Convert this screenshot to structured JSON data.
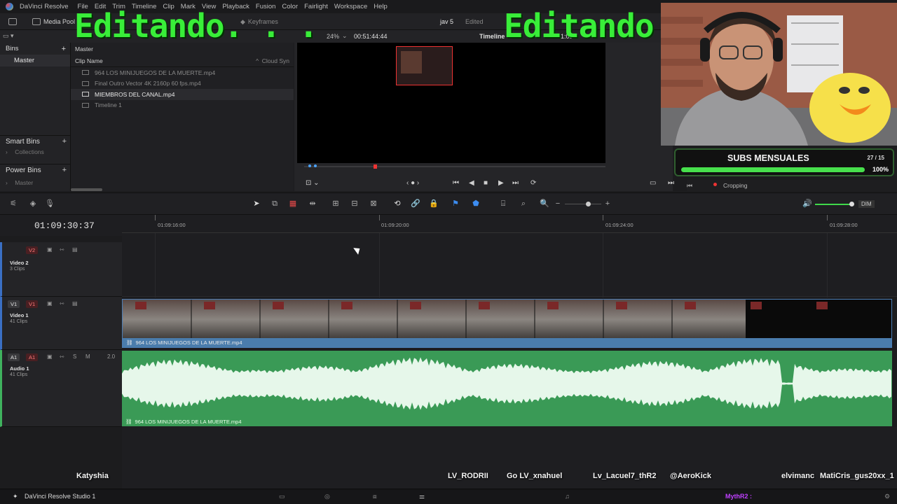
{
  "menubar": {
    "app_name": "DaVinci Resolve",
    "items": [
      "File",
      "Edit",
      "Trim",
      "Timeline",
      "Clip",
      "Mark",
      "View",
      "Playback",
      "Fusion",
      "Color",
      "Fairlight",
      "Workspace",
      "Help"
    ]
  },
  "toolbar": {
    "media_pool": "Media Pool",
    "keyframes": "Keyframes",
    "project_name": "jav 5",
    "project_status": "Edited",
    "zoom": "24%",
    "source_timecode": "00:51:44:44",
    "timeline_label": "Timeline",
    "timeline_tc_partial": "1:09"
  },
  "bins": {
    "header": "Bins",
    "master": "Master",
    "smart_bins": "Smart Bins",
    "collections": "Collections",
    "power_bins": "Power Bins",
    "power_master": "Master"
  },
  "cliplist": {
    "breadcrumb": "Master",
    "col_name": "Clip Name",
    "col_sync": "Cloud Syn",
    "clips": [
      {
        "name": "964 LOS MINIJUEGOS DE LA MUERTE.mp4"
      },
      {
        "name": "Final Outro Vector 4K 2160p 60 fps.mp4"
      },
      {
        "name": "MIEMBROS DEL CANAL.mp4"
      },
      {
        "name": "Timeline 1"
      }
    ]
  },
  "overlay": {
    "title_left": "Editando. . .",
    "title_right": "Editando"
  },
  "subs_widget": {
    "title": "SUBS MENSUALES",
    "count": "27 / 15",
    "percent_label": "100%",
    "fill_fraction": 1.0
  },
  "viewer": {
    "cropping_label": "Cropping"
  },
  "timeline": {
    "timecode": "01:09:30:37",
    "ruler_labels": [
      "01:09:16:00",
      "01:09:20:00",
      "01:09:24:00",
      "01:09:28:00"
    ],
    "dim_label": "DIM",
    "tracks": {
      "v2": {
        "badge": "V2",
        "name": "Video 2",
        "clips": "3 Clips"
      },
      "v1": {
        "badge_a": "V1",
        "badge_b": "V1",
        "name": "Video 1",
        "clips": "41 Clips",
        "clip_label": "964 LOS MINIJUEGOS DE LA MUERTE.mp4"
      },
      "a1": {
        "badge_a": "A1",
        "badge_b": "A1",
        "name": "Audio 1",
        "clips": "41 Clips",
        "level": "2.0",
        "solo": "S",
        "mute": "M",
        "clip_label": "964 LOS MINIJUEGOS DE LA MUERTE.mp4"
      }
    }
  },
  "dock": {
    "app_label": "DaVinci Resolve Studio 1"
  },
  "chat": {
    "names": [
      "Katyshia",
      "LV_RODRII",
      "Go LV_xnahuel",
      "Lv_Lacuel7_thR2",
      "@AeroKick",
      "MythR2 :",
      "elvimanc",
      "MatiCris_gus20xx_1"
    ]
  },
  "colors": {
    "overlay_green": "#39ee39",
    "audio_clip": "#3a9a56",
    "video_label": "#4a7cac",
    "track_badge_red": "#ff7b7b",
    "subs_fill": "#47e04c"
  }
}
